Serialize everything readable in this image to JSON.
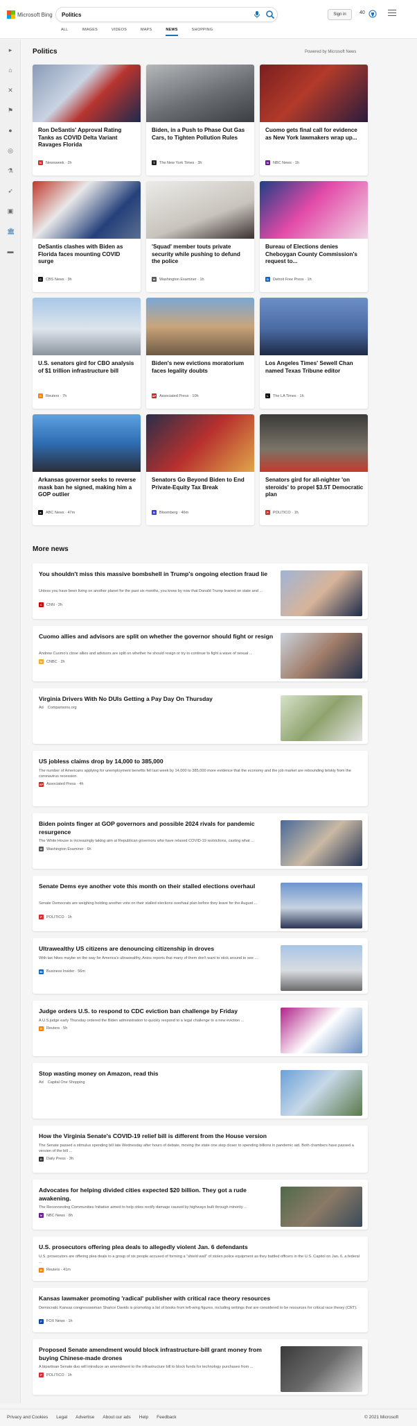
{
  "brand": {
    "name": "Microsoft Bing",
    "colors": [
      "#f25022",
      "#7fba00",
      "#00a4ef",
      "#ffb900"
    ]
  },
  "search": {
    "query": "Politics",
    "placeholder": ""
  },
  "header": {
    "signin_label": "Sign in",
    "rewards_count": "40",
    "mic_icon": "microphone-icon",
    "search_icon": "search-icon",
    "menu_icon": "hamburger-menu-icon"
  },
  "tabs": [
    {
      "label": "ALL"
    },
    {
      "label": "IMAGES"
    },
    {
      "label": "VIDEOS"
    },
    {
      "label": "MAPS"
    },
    {
      "label": "NEWS"
    },
    {
      "label": "SHOPPING"
    }
  ],
  "active_tab": "NEWS",
  "accent_color": "#1a73b8",
  "rail": [
    {
      "icon": "expand-chevron-icon"
    },
    {
      "icon": "home-icon"
    },
    {
      "icon": "flag-icon"
    },
    {
      "icon": "sports-icon"
    },
    {
      "icon": "location-icon"
    },
    {
      "icon": "globe-icon"
    },
    {
      "icon": "microscope-icon"
    },
    {
      "icon": "rocket-icon"
    },
    {
      "icon": "entertainment-icon"
    },
    {
      "icon": "politics-building-icon"
    },
    {
      "icon": "video-icon"
    }
  ],
  "politics": {
    "title": "Politics",
    "powered_by": "Powered by Microsoft News",
    "cards": [
      {
        "title": "Ron DeSantis' Approval Rating Tanks as COVID Delta Variant Ravages Florida",
        "source": "Newsweek",
        "time": "2h",
        "logo_color": "#d32f2f",
        "logo_letter": "N"
      },
      {
        "title": "Biden, in a Push to Phase Out Gas Cars, to Tighten Pollution Rules",
        "source": "The New York Times",
        "time": "3h",
        "logo_color": "#222222",
        "logo_letter": "T"
      },
      {
        "title": "Cuomo gets final call for evidence as New York lawmakers wrap up...",
        "source": "NBC News",
        "time": "1h",
        "logo_color": "#6a1b9a",
        "logo_letter": "N"
      },
      {
        "title": "DeSantis clashes with Biden as Florida faces mounting COVID surge",
        "source": "CBS News",
        "time": "3h",
        "logo_color": "#111111",
        "logo_letter": "C"
      },
      {
        "title": "'Squad' member touts private security while pushing to defund the police",
        "source": "Washington Examiner",
        "time": "1h",
        "logo_color": "#555555",
        "logo_letter": "W"
      },
      {
        "title": "Bureau of Elections denies Cheboygan County Commission's request to...",
        "source": "Detroit Free Press",
        "time": "1h",
        "logo_color": "#1565c0",
        "logo_letter": "D"
      },
      {
        "title": "U.S. senators gird for CBO analysis of $1 trillion infrastructure bill",
        "source": "Reuters",
        "time": "7h",
        "logo_color": "#ff8000",
        "logo_letter": "R"
      },
      {
        "title": "Biden's new evictions moratorium faces legality doubts",
        "source": "Associated Press",
        "time": "10h",
        "logo_color": "#c62828",
        "logo_letter": "AP"
      },
      {
        "title": "Los Angeles Times' Sewell Chan named Texas Tribune editor",
        "source": "The LA Times",
        "time": "1h",
        "logo_color": "#111111",
        "logo_letter": "L"
      },
      {
        "title": "Arkansas governor seeks to reverse mask ban he signed, making him a GOP outlier",
        "source": "ABC News",
        "time": "47m",
        "logo_color": "#111111",
        "logo_letter": "a"
      },
      {
        "title": "Senators Go Beyond Biden to End Private-Equity Tax Break",
        "source": "Bloomberg",
        "time": "46m",
        "logo_color": "#3c3cd6",
        "logo_letter": "B"
      },
      {
        "title": "Senators gird for all-nighter 'on steroids' to propel $3.5T Democratic plan",
        "source": "POLITICO",
        "time": "1h",
        "logo_color": "#d32f2f",
        "logo_letter": "P"
      }
    ]
  },
  "more_news": {
    "title": "More news",
    "items": [
      {
        "title": "You shouldn't miss this massive bombshell in Trump's ongoing election fraud lie",
        "snippet": "Unless you have been living on another planet for the past six months, you know by now that Donald Trump leaned on state and ...",
        "source": "CNN",
        "time": "2h",
        "logo_color": "#cc0000",
        "logo_letter": "C",
        "ad": ""
      },
      {
        "title": "Cuomo allies and advisors are split on whether the governor should fight or resign",
        "snippet": "Andrew Cuomo's close allies and advisors are split on whether he should resign or try to continue to fight a wave of sexual ...",
        "source": "CNBC",
        "time": "2h",
        "logo_color": "#f9a825",
        "logo_letter": "N",
        "ad": ""
      },
      {
        "title": "Virginia Drivers With No DUIs Getting a Pay Day On Thursday",
        "snippet": "",
        "source": "Comparisons.org",
        "time": "",
        "logo_color": "",
        "logo_letter": "",
        "ad": "Ad"
      },
      {
        "title": "US jobless claims drop by 14,000 to 385,000",
        "snippet": "The number of Americans applying for unemployment benefits fell last week by 14,000 to 385,000 more evidence that the economy and the job market are rebounding briskly from the coronavirus recession.",
        "source": "Associated Press",
        "time": "4h",
        "logo_color": "#c62828",
        "logo_letter": "AP",
        "ad": ""
      },
      {
        "title": "Biden points finger at GOP governors and possible 2024 rivals for pandemic resurgence",
        "snippet": "The White House is increasingly taking aim at Republican governors who have relaxed COVID-19 restrictions, casting what ...",
        "source": "Washington Examiner",
        "time": "6h",
        "logo_color": "#555555",
        "logo_letter": "W",
        "ad": ""
      },
      {
        "title": "Senate Dems eye another vote this month on their stalled elections overhaul",
        "snippet": "Senate Democrats are weighing holding another vote on their stalled elections overhaul plan before they leave for the August ...",
        "source": "POLITICO",
        "time": "1h",
        "logo_color": "#d32f2f",
        "logo_letter": "P",
        "ad": ""
      },
      {
        "title": "Ultrawealthy US citizens are denouncing citizenship in droves",
        "snippet": "With tax hikes maybe on the way for America's ultrawealthy, Axios reports that many of them don't want to stick around to see ...",
        "source": "Business Insider",
        "time": "56m",
        "logo_color": "#1565c0",
        "logo_letter": "BI",
        "ad": ""
      },
      {
        "title": "Judge orders U.S. to respond to CDC eviction ban challenge by Friday",
        "snippet": "A U.S.judge early Thursday ordered the Biden administration to quickly respond to a legal challenge to a new eviction ...",
        "source": "Reuters",
        "time": "5h",
        "logo_color": "#ff8000",
        "logo_letter": "R",
        "ad": ""
      },
      {
        "title": "Stop wasting money on Amazon, read this",
        "snippet": "",
        "source": "Capital One Shopping",
        "time": "",
        "logo_color": "",
        "logo_letter": "",
        "ad": "Ad"
      },
      {
        "title": "How the Virginia Senate's COVID-19 relief bill is different from the House version",
        "snippet": "The Senate passed a stimulus spending bill late Wednesday after hours of debate, moving the state one step closer to spending billions in pandemic aid. Both chambers have passed a version of the bill ...",
        "source": "Daily Press",
        "time": "3h",
        "logo_color": "#333333",
        "logo_letter": "D",
        "ad": ""
      },
      {
        "title": "Advocates for helping divided cities expected $20 billion. They got a rude awakening.",
        "snippet": "The Reconnecting Communities Initiative aimed to help cities rectify damage caused by highways built through minority ...",
        "source": "NBC News",
        "time": "8h",
        "logo_color": "#6a1b9a",
        "logo_letter": "N",
        "ad": ""
      },
      {
        "title": "U.S. prosecutors offering plea deals to allegedly violent Jan. 6 defendants",
        "snippet": "U.S. prosecutors are offering plea deals to a group of six people accused of forming a \"shield wall\" of stolen police equipment as they battled officers in the U.S. Capitol on Jan. 6, a federal ...",
        "source": "Reuters",
        "time": "41m",
        "logo_color": "#ff8000",
        "logo_letter": "R",
        "ad": ""
      },
      {
        "title": "Kansas lawmaker promoting 'radical' publisher with critical race theory resources",
        "snippet": "Democratic Kansas congresswoman Sharice Davids is promoting a list of books from left-wing figures, including writings that are considered to be resources for critical race theory (CRT).",
        "source": "FOX News",
        "time": "1h",
        "logo_color": "#0d47a1",
        "logo_letter": "F",
        "ad": ""
      },
      {
        "title": "Proposed Senate amendment would block infrastructure-bill grant money from buying Chinese-made drones",
        "snippet": "A bipartisan Senate duo will introduce an amendment to the infrastructure bill to block funds for technology purchases from ...",
        "source": "POLITICO",
        "time": "1h",
        "logo_color": "#d32f2f",
        "logo_letter": "P",
        "ad": ""
      }
    ]
  },
  "footer": {
    "links": [
      "Privacy and Cookies",
      "Legal",
      "Advertise",
      "About our ads",
      "Help",
      "Feedback"
    ],
    "copyright": "© 2021 Microsoft"
  }
}
